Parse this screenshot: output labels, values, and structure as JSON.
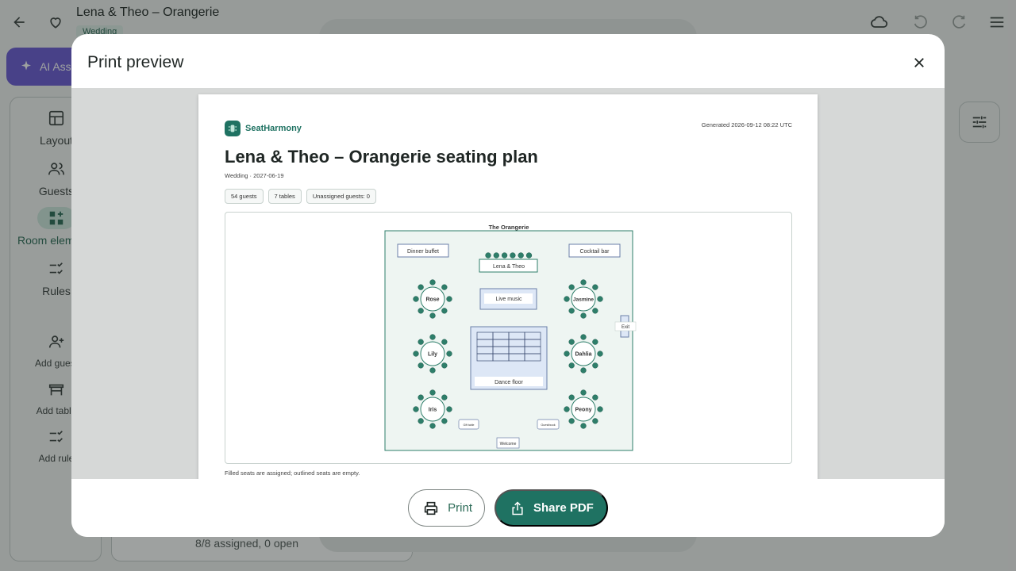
{
  "app": {
    "title": "Lena & Theo – Orangerie",
    "chip": "Wedding",
    "ai_button": "AI Assistant",
    "bottom_card_text": "8/8 assigned, 0 open"
  },
  "sidebar": {
    "items": [
      {
        "label": "Layout"
      },
      {
        "label": "Guests"
      },
      {
        "label": "Room elements"
      },
      {
        "label": "Rules"
      },
      {
        "label": "Add guest"
      },
      {
        "label": "Add table"
      },
      {
        "label": "Add rule"
      }
    ]
  },
  "dialog": {
    "title": "Print preview",
    "print_label": "Print",
    "share_label": "Share PDF"
  },
  "report": {
    "brand": "SeatHarmony",
    "generated": "Generated 2026-09-12 08:22 UTC",
    "title": "Lena & Theo – Orangerie seating plan",
    "subtitle": "Wedding · 2027-06-19",
    "chips": [
      "54 guests",
      "7 tables",
      "Unassigned guests: 0"
    ],
    "legend_note": "Filled seats are assigned; outlined seats are empty."
  },
  "floorplan": {
    "room_name": "The Orangerie",
    "elements": {
      "buffet": "Dinner buffet",
      "bar": "Cocktail bar",
      "head_table": "Lena & Theo",
      "music": "Live music",
      "dance": "Dance floor",
      "exit": "Exit",
      "welcome": "Welcome",
      "gift": "Gift table",
      "guestbook": "Guestbook"
    },
    "tables": [
      {
        "name": "Rose",
        "seats": 8
      },
      {
        "name": "Jasmine",
        "seats": 8
      },
      {
        "name": "Lily",
        "seats": 8
      },
      {
        "name": "Dahlia",
        "seats": 8
      },
      {
        "name": "Iris",
        "seats": 8
      },
      {
        "name": "Peony",
        "seats": 8
      }
    ],
    "head_table_seats": 6,
    "colors": {
      "room_fill": "#eef5f2",
      "seat_fill": "#2e7e6a",
      "element_fill": "#dde7f6",
      "element_stroke": "#6b7fa8"
    }
  }
}
